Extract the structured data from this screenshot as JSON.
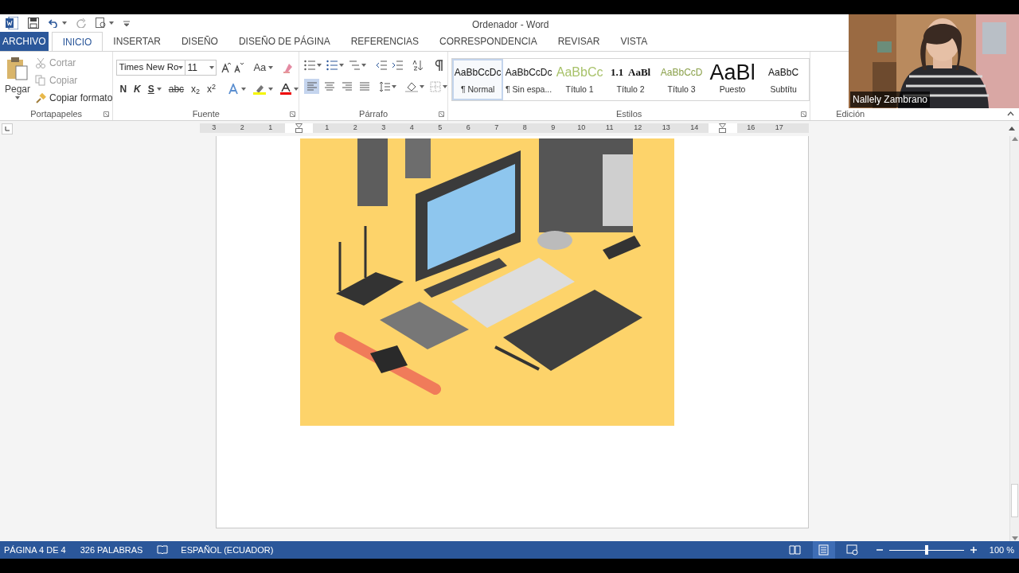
{
  "window": {
    "title": "Ordenador - Word"
  },
  "tabs": [
    {
      "label": "ARCHIVO",
      "kind": "file",
      "selected": false
    },
    {
      "label": "INICIO",
      "kind": "tab",
      "selected": true
    },
    {
      "label": "INSERTAR",
      "kind": "tab",
      "selected": false
    },
    {
      "label": "DISEÑO",
      "kind": "tab",
      "selected": false
    },
    {
      "label": "DISEÑO DE PÁGINA",
      "kind": "tab",
      "selected": false
    },
    {
      "label": "REFERENCIAS",
      "kind": "tab",
      "selected": false
    },
    {
      "label": "CORRESPONDENCIA",
      "kind": "tab",
      "selected": false
    },
    {
      "label": "REVISAR",
      "kind": "tab",
      "selected": false
    },
    {
      "label": "VISTA",
      "kind": "tab",
      "selected": false
    }
  ],
  "clipboard": {
    "group_label": "Portapapeles",
    "paste": "Pegar",
    "actions": [
      {
        "label": "Cortar",
        "disabled": true
      },
      {
        "label": "Copiar",
        "disabled": true
      },
      {
        "label": "Copiar formato",
        "disabled": false
      }
    ]
  },
  "font": {
    "group_label": "Fuente",
    "font_name": "Times New Ro",
    "font_size": "11",
    "case_button": "Aa",
    "format_buttons": [
      "N",
      "K",
      "S",
      "abc",
      "x$_{2}$",
      "x$^{2}$"
    ]
  },
  "paragraph": {
    "group_label": "Párrafo",
    "alignment_buttons": [
      {
        "selected": true
      },
      {
        "selected": false
      },
      {
        "selected": false
      },
      {
        "selected": false
      }
    ]
  },
  "styles": {
    "group_label": "Estilos",
    "items": [
      {
        "preview": "AaBbCcDc",
        "name": "¶ Normal",
        "kind": "normal",
        "selected": true
      },
      {
        "preview": "AaBbCcDc",
        "name": "¶ Sin espa...",
        "kind": "normal",
        "selected": false
      },
      {
        "preview": "AaBbCc",
        "name": "Título 1",
        "kind": "heading1",
        "selected": false
      },
      {
        "preview": "1.1  AaBl",
        "name": "Título 2",
        "kind": "heading2",
        "selected": false
      },
      {
        "preview": "AaBbCcD",
        "name": "Título 3",
        "kind": "heading3",
        "selected": false
      },
      {
        "preview": "AaBl",
        "name": "Puesto",
        "kind": "title",
        "selected": false
      },
      {
        "preview": "AaBbC",
        "name": "Subtítu",
        "kind": "normal",
        "selected": false
      }
    ]
  },
  "editing": {
    "group_label": "Edición"
  },
  "ruler": {
    "ticks": [
      {
        "label": "3"
      },
      {
        "label": "2"
      },
      {
        "label": "1"
      },
      {
        "kind": "indent-marker"
      },
      {
        "label": "1"
      },
      {
        "label": "2"
      },
      {
        "label": "3"
      },
      {
        "label": "4"
      },
      {
        "label": "5"
      },
      {
        "label": "6"
      },
      {
        "label": "7"
      },
      {
        "label": "8"
      },
      {
        "label": "9"
      },
      {
        "label": "10"
      },
      {
        "label": "11"
      },
      {
        "label": "12"
      },
      {
        "label": "13"
      },
      {
        "label": "14"
      },
      {
        "kind": "indent-marker"
      },
      {
        "label": "16"
      },
      {
        "label": "17"
      }
    ]
  },
  "video_tile": {
    "participant_name": "Nallely Zambrano"
  },
  "status_bar": {
    "page": "PÁGINA 4 DE 4",
    "words": "326 PALABRAS",
    "language": "ESPAÑOL (ECUADOR)",
    "views": [
      {
        "selected": false
      },
      {
        "selected": true
      },
      {
        "selected": false
      }
    ],
    "zoom": {
      "level": 0.5,
      "reading": "100 %"
    }
  }
}
